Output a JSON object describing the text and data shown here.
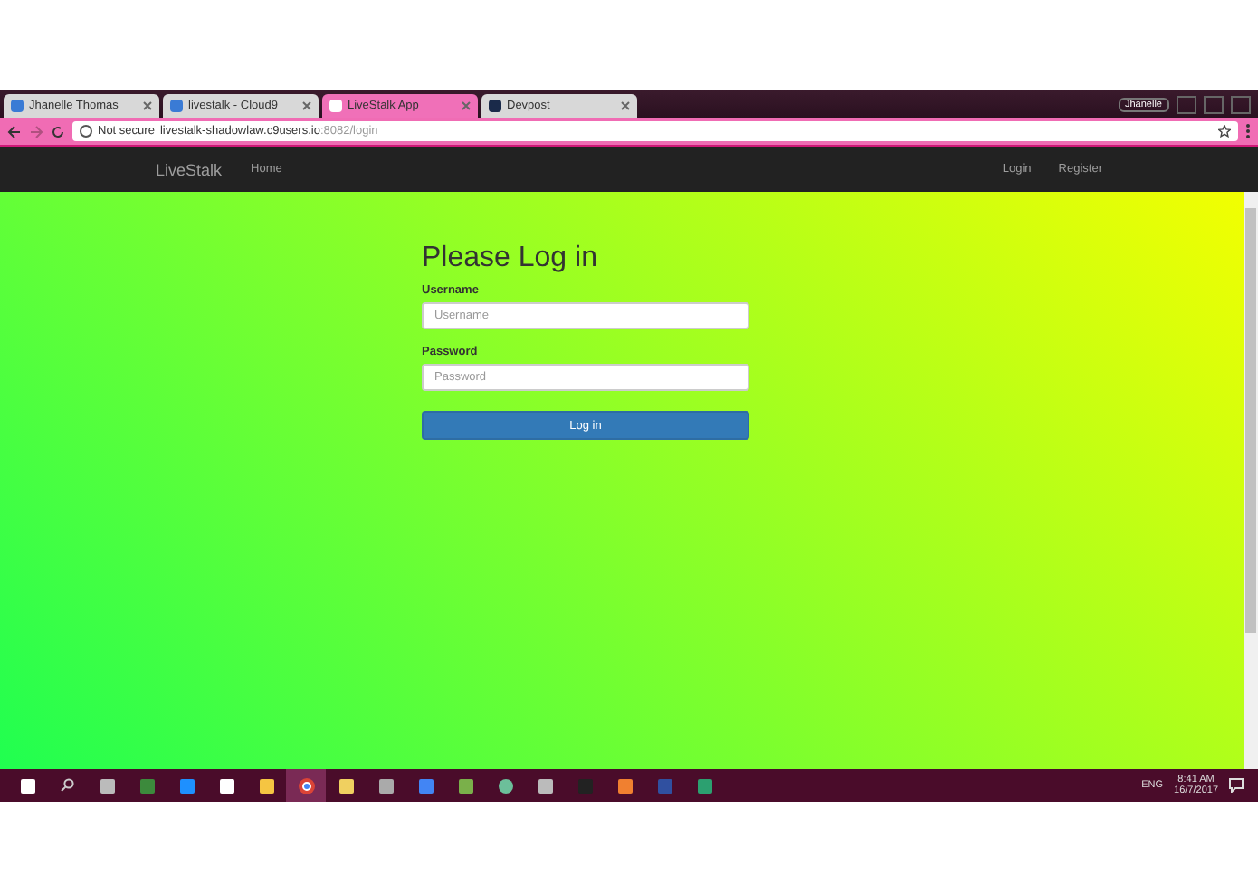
{
  "browser": {
    "tabs": [
      {
        "title": "Jhanelle Thomas",
        "selected": false
      },
      {
        "title": "livestalk - Cloud9",
        "selected": false
      },
      {
        "title": "LiveStalk App",
        "selected": true
      },
      {
        "title": "Devpost",
        "selected": false
      }
    ],
    "profile": "Jhanelle",
    "security": "Not secure",
    "url_host": "livestalk-shadowlaw.c9users.io",
    "url_path": ":8082/login"
  },
  "navbar": {
    "brand": "LiveStalk",
    "left_links": [
      "Home"
    ],
    "right_links": [
      "Login",
      "Register"
    ]
  },
  "form": {
    "title": "Please Log in",
    "fields": [
      {
        "label": "Username",
        "placeholder": "Username"
      },
      {
        "label": "Password",
        "placeholder": "Password"
      }
    ],
    "submit": "Log in"
  },
  "taskbar": {
    "apps": [
      {
        "selected": false
      },
      {
        "selected": false
      },
      {
        "selected": false
      },
      {
        "selected": false
      },
      {
        "selected": false
      },
      {
        "selected": false
      },
      {
        "selected": false
      },
      {
        "selected": true
      },
      {
        "selected": false
      },
      {
        "selected": false
      },
      {
        "selected": false
      },
      {
        "selected": false
      },
      {
        "selected": false
      },
      {
        "selected": false
      },
      {
        "selected": false
      },
      {
        "selected": false
      },
      {
        "selected": false
      },
      {
        "selected": false
      }
    ],
    "language": "ENG",
    "time": "8:41 AM",
    "date": "16/7/2017"
  }
}
